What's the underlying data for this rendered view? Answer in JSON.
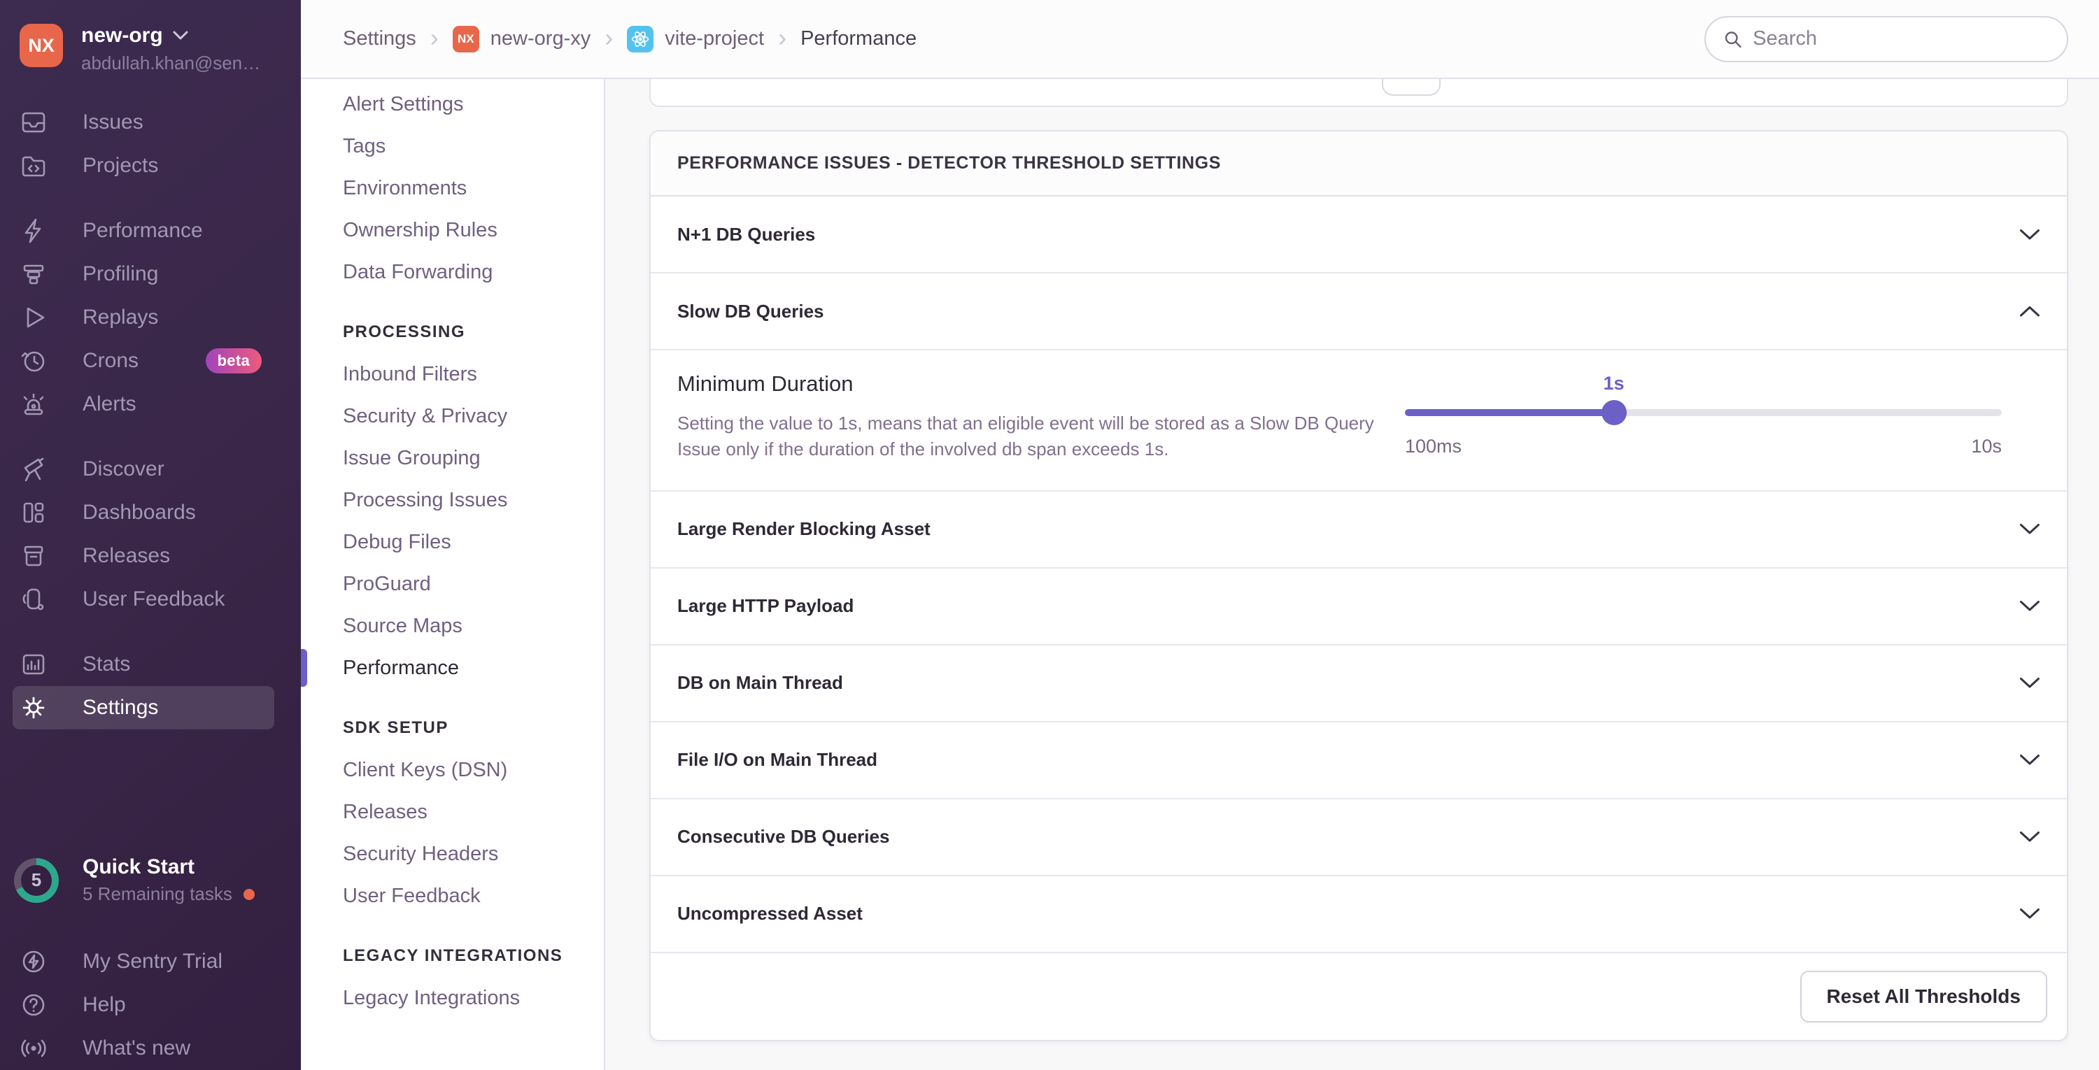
{
  "org": {
    "initials": "NX",
    "name": "new-org",
    "email": "abdullah.khan@sen…"
  },
  "sidebar": {
    "groups": [
      {
        "items": [
          {
            "label": "Issues"
          },
          {
            "label": "Projects"
          }
        ]
      },
      {
        "items": [
          {
            "label": "Performance"
          },
          {
            "label": "Profiling"
          },
          {
            "label": "Replays"
          },
          {
            "label": "Crons",
            "badge": "beta"
          },
          {
            "label": "Alerts"
          }
        ]
      },
      {
        "items": [
          {
            "label": "Discover"
          },
          {
            "label": "Dashboards"
          },
          {
            "label": "Releases"
          },
          {
            "label": "User Feedback"
          }
        ]
      },
      {
        "items": [
          {
            "label": "Stats"
          },
          {
            "label": "Settings"
          }
        ]
      }
    ],
    "quick_start": {
      "count": "5",
      "title": "Quick Start",
      "subtitle": "5 Remaining tasks"
    },
    "footer_items": [
      {
        "label": "My Sentry Trial"
      },
      {
        "label": "Help"
      },
      {
        "label": "What's new"
      }
    ]
  },
  "settings_nav": {
    "top_items": [
      {
        "label": "Alert Settings"
      },
      {
        "label": "Tags"
      },
      {
        "label": "Environments"
      },
      {
        "label": "Ownership Rules"
      },
      {
        "label": "Data Forwarding"
      }
    ],
    "sections": [
      {
        "header": "PROCESSING",
        "items": [
          {
            "label": "Inbound Filters"
          },
          {
            "label": "Security & Privacy"
          },
          {
            "label": "Issue Grouping"
          },
          {
            "label": "Processing Issues"
          },
          {
            "label": "Debug Files"
          },
          {
            "label": "ProGuard"
          },
          {
            "label": "Source Maps"
          },
          {
            "label": "Performance"
          }
        ]
      },
      {
        "header": "SDK SETUP",
        "items": [
          {
            "label": "Client Keys (DSN)"
          },
          {
            "label": "Releases"
          },
          {
            "label": "Security Headers"
          },
          {
            "label": "User Feedback"
          }
        ]
      },
      {
        "header": "LEGACY INTEGRATIONS",
        "items": [
          {
            "label": "Legacy Integrations"
          }
        ]
      }
    ]
  },
  "breadcrumb": {
    "crumbs": [
      {
        "label": "Settings"
      },
      {
        "label": "new-org-xy",
        "badge": "NX"
      },
      {
        "label": "vite-project",
        "badge": "react"
      },
      {
        "label": "Performance"
      }
    ]
  },
  "search": {
    "placeholder": "Search"
  },
  "panel": {
    "header": "PERFORMANCE ISSUES - DETECTOR THRESHOLD SETTINGS",
    "rows": [
      {
        "label": "N+1 DB Queries",
        "state": "collapsed"
      },
      {
        "label": "Slow DB Queries",
        "state": "expanded"
      },
      {
        "label": "Large Render Blocking Asset",
        "state": "collapsed"
      },
      {
        "label": "Large HTTP Payload",
        "state": "collapsed"
      },
      {
        "label": "DB on Main Thread",
        "state": "collapsed"
      },
      {
        "label": "File I/O on Main Thread",
        "state": "collapsed"
      },
      {
        "label": "Consecutive DB Queries",
        "state": "collapsed"
      },
      {
        "label": "Uncompressed Asset",
        "state": "collapsed"
      }
    ],
    "expanded_setting": {
      "title": "Minimum Duration",
      "description": "Setting the value to 1s, means that an eligible event will be stored as a Slow DB Query Issue only if the duration of the involved db span exceeds 1s.",
      "slider": {
        "value": "1s",
        "min": "100ms",
        "max": "10s",
        "percent": 35
      }
    },
    "footer_button": "Reset All Thresholds"
  },
  "colors": {
    "accent": "#6c5fc7",
    "org_avatar": "#e8674a",
    "react_badge": "#53c3ee",
    "quickstart_ring": "#2ea88c",
    "notification_dot": "#e8674a",
    "beta_gradient_start": "#a144bb",
    "beta_gradient_end": "#ec5b7d"
  }
}
